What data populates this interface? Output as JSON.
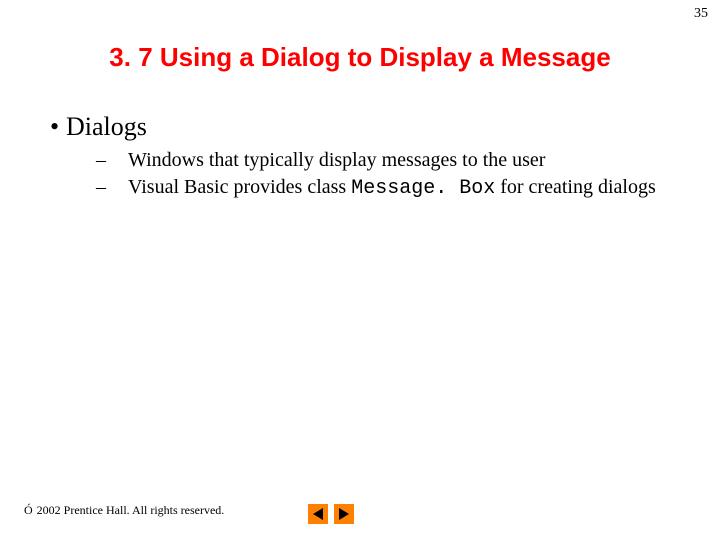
{
  "page_number": "35",
  "title": "3. 7 Using a Dialog to Display a Message",
  "bullets": {
    "l1": {
      "label": "Dialogs"
    },
    "sub": [
      {
        "text": "Windows that typically display messages to the user"
      },
      {
        "prefix": "Visual Basic provides class ",
        "code": "Message. Box",
        "suffix": " for creating dialogs"
      }
    ]
  },
  "footer": {
    "copyright_symbol": "Ó",
    "text": " 2002 Prentice Hall. All rights reserved."
  }
}
